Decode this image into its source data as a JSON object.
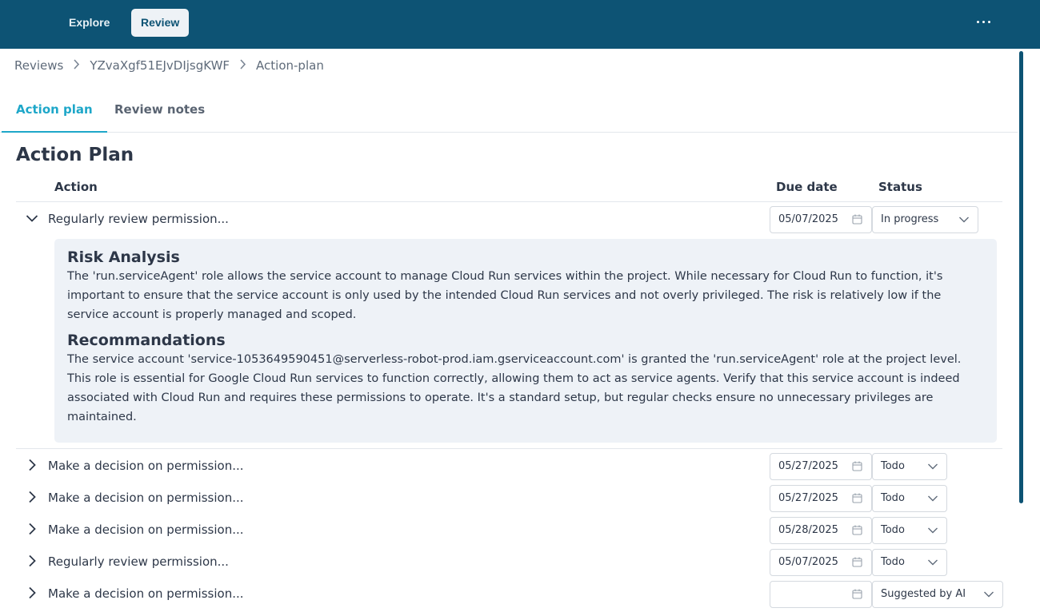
{
  "nav": {
    "explore": "Explore",
    "review": "Review"
  },
  "breadcrumb": {
    "root": "Reviews",
    "review_id": "YZvaXgf51EJvDIjsgKWF",
    "current": "Action-plan"
  },
  "tabs": {
    "action_plan": "Action plan",
    "review_notes": "Review notes"
  },
  "page": {
    "title": "Action Plan"
  },
  "table": {
    "col_action": "Action",
    "col_due": "Due date",
    "col_status": "Status"
  },
  "rows": [
    {
      "label": "Regularly review permission...",
      "due": "05/07/2025",
      "status": "In progress",
      "expanded": true
    },
    {
      "label": "Make a decision on permission...",
      "due": "05/27/2025",
      "status": "Todo"
    },
    {
      "label": "Make a decision on permission...",
      "due": "05/27/2025",
      "status": "Todo"
    },
    {
      "label": "Make a decision on permission...",
      "due": "05/28/2025",
      "status": "Todo"
    },
    {
      "label": "Regularly review permission...",
      "due": "05/07/2025",
      "status": "Todo"
    },
    {
      "label": "Make a decision on permission...",
      "due": "",
      "status": "Suggested by AI"
    }
  ],
  "detail": {
    "risk_title": "Risk Analysis",
    "risk_text": "The 'run.serviceAgent' role allows the service account to manage Cloud Run services within the project. While necessary for Cloud Run to function, it's important to ensure that the service account is only used by the intended Cloud Run services and not overly privileged. The risk is relatively low if the service account is properly managed and scoped.",
    "rec_title": "Recommandations",
    "rec_text": "The service account 'service-1053649590451@serverless-robot-prod.iam.gserviceaccount.com' is granted the 'run.serviceAgent' role at the project level. This role is essential for Google Cloud Run services to function correctly, allowing them to act as service agents. Verify that this service account is indeed associated with Cloud Run and requires these permissions to operate. It's a standard setup, but regular checks ensure no unnecessary privileges are maintained."
  },
  "colors": {
    "topbar": "#0d5374",
    "accent": "#1ea7c9",
    "panel": "#eef2f7"
  }
}
